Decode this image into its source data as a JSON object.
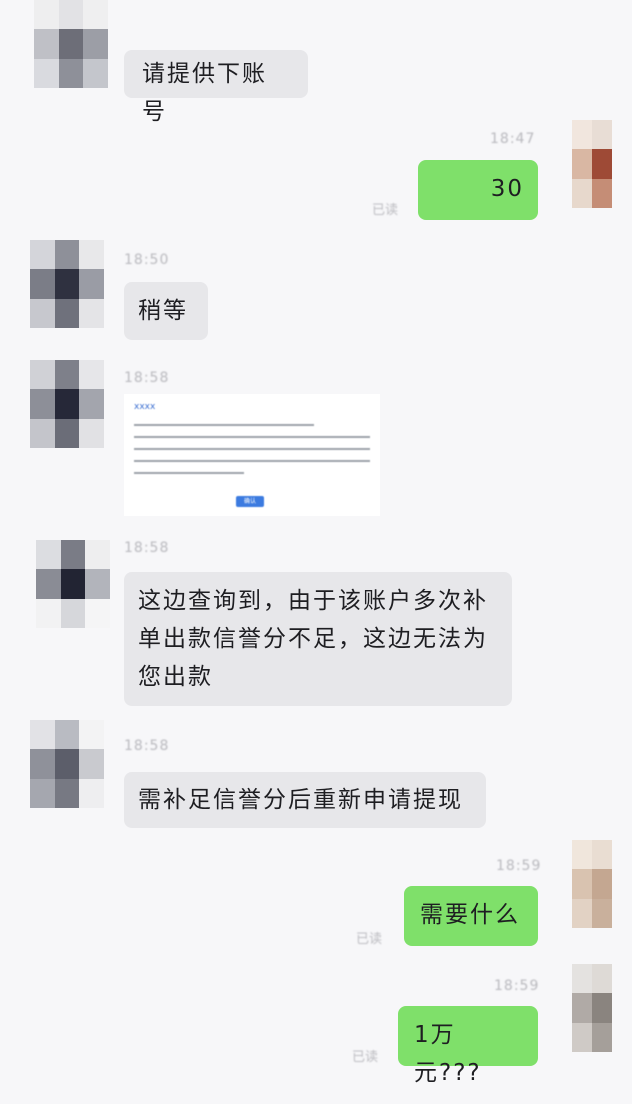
{
  "messages": {
    "m1": {
      "text": "请提供下账号"
    },
    "m2": {
      "time": "18:47",
      "text": "30",
      "status": "已读"
    },
    "m3": {
      "time": "18:50",
      "text": "稍等"
    },
    "m4": {
      "time": "18:58",
      "doc_title": "xxxx",
      "doc_button": "确认"
    },
    "m5": {
      "time": "18:58",
      "text": "这边查询到，由于该账户多次补单出款信誉分不足，这边无法为您出款"
    },
    "m6": {
      "time": "18:58",
      "text": "需补足信誉分后重新申请提现"
    },
    "m7": {
      "time": "18:59",
      "text": "需要什么",
      "status": "已读"
    },
    "m8": {
      "time": "18:59",
      "text": "1万元???",
      "status": "已读"
    }
  },
  "colors": {
    "background": "#f7f7f9",
    "incoming_bubble": "#e7e7ea",
    "outgoing_bubble": "#7fe06a"
  },
  "icons": [
    "avatar"
  ]
}
